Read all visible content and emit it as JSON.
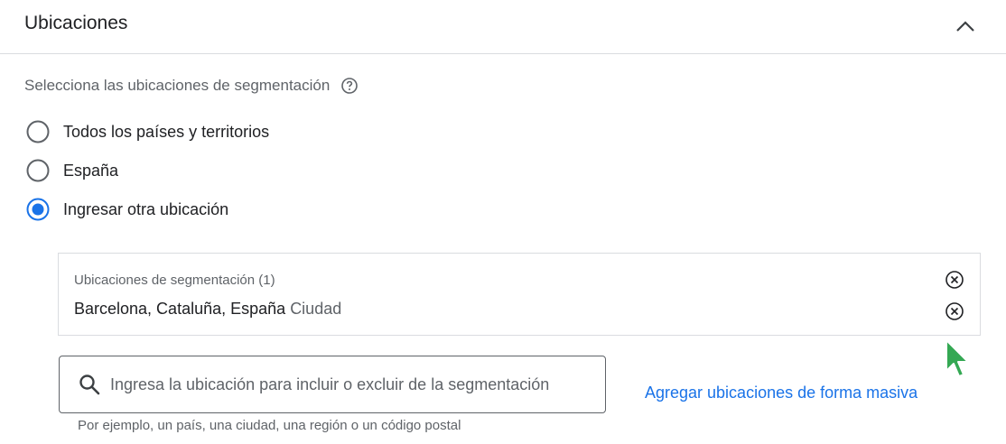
{
  "header": {
    "title": "Ubicaciones"
  },
  "locations": {
    "prompt": "Selecciona las ubicaciones de segmentación",
    "options": [
      {
        "label": "Todos los países y territorios",
        "selected": false
      },
      {
        "label": "España",
        "selected": false
      },
      {
        "label": "Ingresar otra ubicación",
        "selected": true
      }
    ]
  },
  "targets": {
    "label": "Ubicaciones de segmentación (1)",
    "items": [
      {
        "name": "Barcelona, Cataluña, España",
        "type": "Ciudad"
      }
    ]
  },
  "search": {
    "placeholder": "Ingresa la ubicación para incluir o excluir de la segmentación",
    "hint": "Por ejemplo, un país, una ciudad, una región o un código postal"
  },
  "bulk_link": "Agregar ubicaciones de forma masiva",
  "colors": {
    "accent": "#1a73e8",
    "cursor": "#34a853",
    "text": "#202124",
    "muted": "#5f6368"
  },
  "icons": [
    "chevron-up-icon",
    "help-icon",
    "clear-icon",
    "search-icon",
    "cursor-icon"
  ]
}
